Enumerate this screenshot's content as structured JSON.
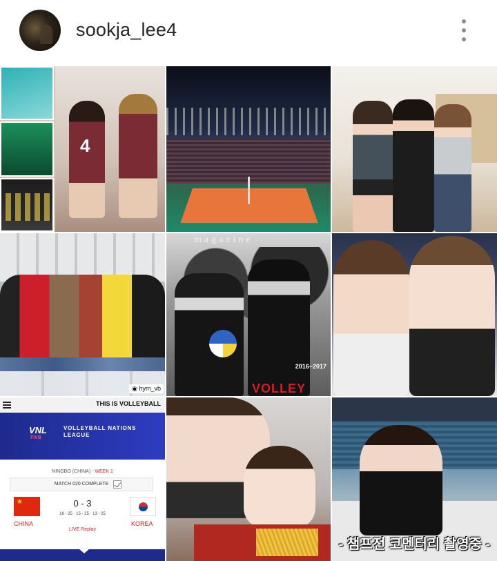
{
  "profile": {
    "username": "sookja_lee4"
  },
  "posts": [
    {
      "id": "post-1",
      "jersey_number": "4"
    },
    {
      "id": "post-2"
    },
    {
      "id": "post-3"
    },
    {
      "id": "post-4",
      "tag": "hym_vb"
    },
    {
      "id": "post-5",
      "magazine": "magazine",
      "season": "2016~2017",
      "brand": "VOLLEY"
    },
    {
      "id": "post-6"
    },
    {
      "id": "post-7",
      "top_text": "THIS IS VOLLEYBALL",
      "logo": "VNL",
      "logo_sub": "FIVB",
      "league_name": "VOLLEYBALL NATIONS LEAGUE",
      "venue": "NINGBO (CHINA)",
      "week": "- WEEK 1",
      "status": "MATCH 020 COMPLETE",
      "score": "0 - 3",
      "sets": "16 - 25 · 15 - 25 · 13 - 25",
      "team_home": "CHINA",
      "team_away": "KOREA",
      "replay": "LIVE Replay"
    },
    {
      "id": "post-8"
    },
    {
      "id": "post-9",
      "subtitle": "- 챔프전 코멘터리 촬영중 -"
    }
  ],
  "icons": {
    "more": "more-vertical-icon"
  },
  "colors": {
    "vnl_blue": "#1e2a8c",
    "text": "#262626",
    "icon_gray": "#8e8e8e"
  }
}
